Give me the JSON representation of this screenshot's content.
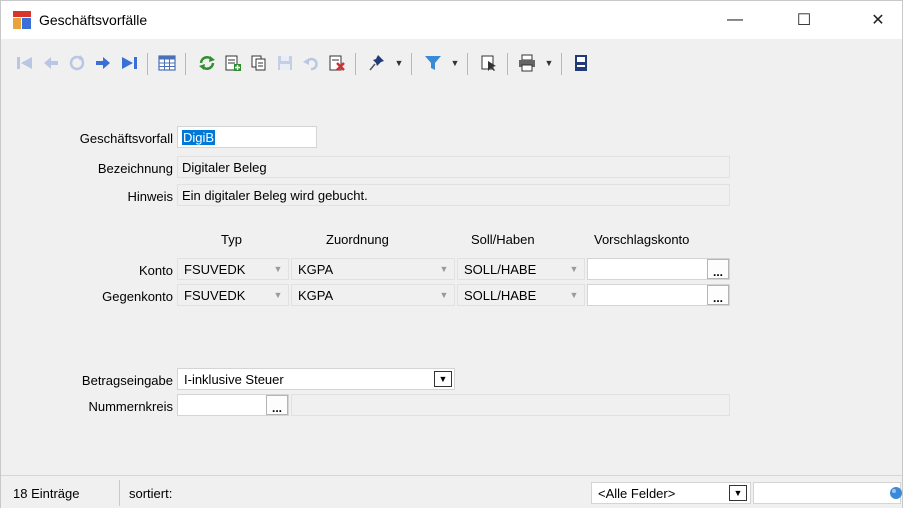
{
  "window": {
    "title": "Geschäftsvorfälle",
    "minimize_label": "—",
    "maximize_label": "☐",
    "close_label": "✕"
  },
  "toolbar": {
    "icons": [
      "first-record-icon",
      "previous-record-icon",
      "reload-icon",
      "next-record-icon",
      "last-record-icon",
      "table-view-icon",
      "refresh-icon",
      "new-record-icon",
      "copy-record-icon",
      "save-icon",
      "undo-icon",
      "delete-icon",
      "pin-icon",
      "filter-icon",
      "select-cursor-icon",
      "print-icon",
      "export-icon"
    ]
  },
  "form": {
    "geschaeftsvorfall_label": "Geschäftsvorfall",
    "geschaeftsvorfall_value": "DigiB",
    "bezeichnung_label": "Bezeichnung",
    "bezeichnung_value": "Digitaler Beleg",
    "hinweis_label": "Hinweis",
    "hinweis_value": "Ein digitaler Beleg wird gebucht.",
    "headers": {
      "typ": "Typ",
      "zuordnung": "Zuordnung",
      "soll_haben": "Soll/Haben",
      "vorschlagskonto": "Vorschlagskonto"
    },
    "konto": {
      "label": "Konto",
      "typ": "FSUVEDK",
      "zuordnung": "KGPA",
      "soll_haben": "SOLL/HABE",
      "vorschlagskonto": ""
    },
    "gegenkonto": {
      "label": "Gegenkonto",
      "typ": "FSUVEDK",
      "zuordnung": "KGPA",
      "soll_haben": "SOLL/HABE",
      "vorschlagskonto": ""
    },
    "betragseingabe_label": "Betragseingabe",
    "betragseingabe_value": "I-inklusive Steuer",
    "nummernkreis_label": "Nummernkreis",
    "nummernkreis_value": "",
    "dots_label": "..."
  },
  "status": {
    "entries": "18 Einträge",
    "sorted": "sortiert:",
    "field_filter": "<Alle Felder>",
    "search_value": ""
  },
  "colors": {
    "accent": "#0078d7",
    "nav_blue": "#3a6fd8",
    "nav_disabled": "#b9c7e4",
    "green": "#2f8f2f",
    "red": "#d32f2f"
  }
}
